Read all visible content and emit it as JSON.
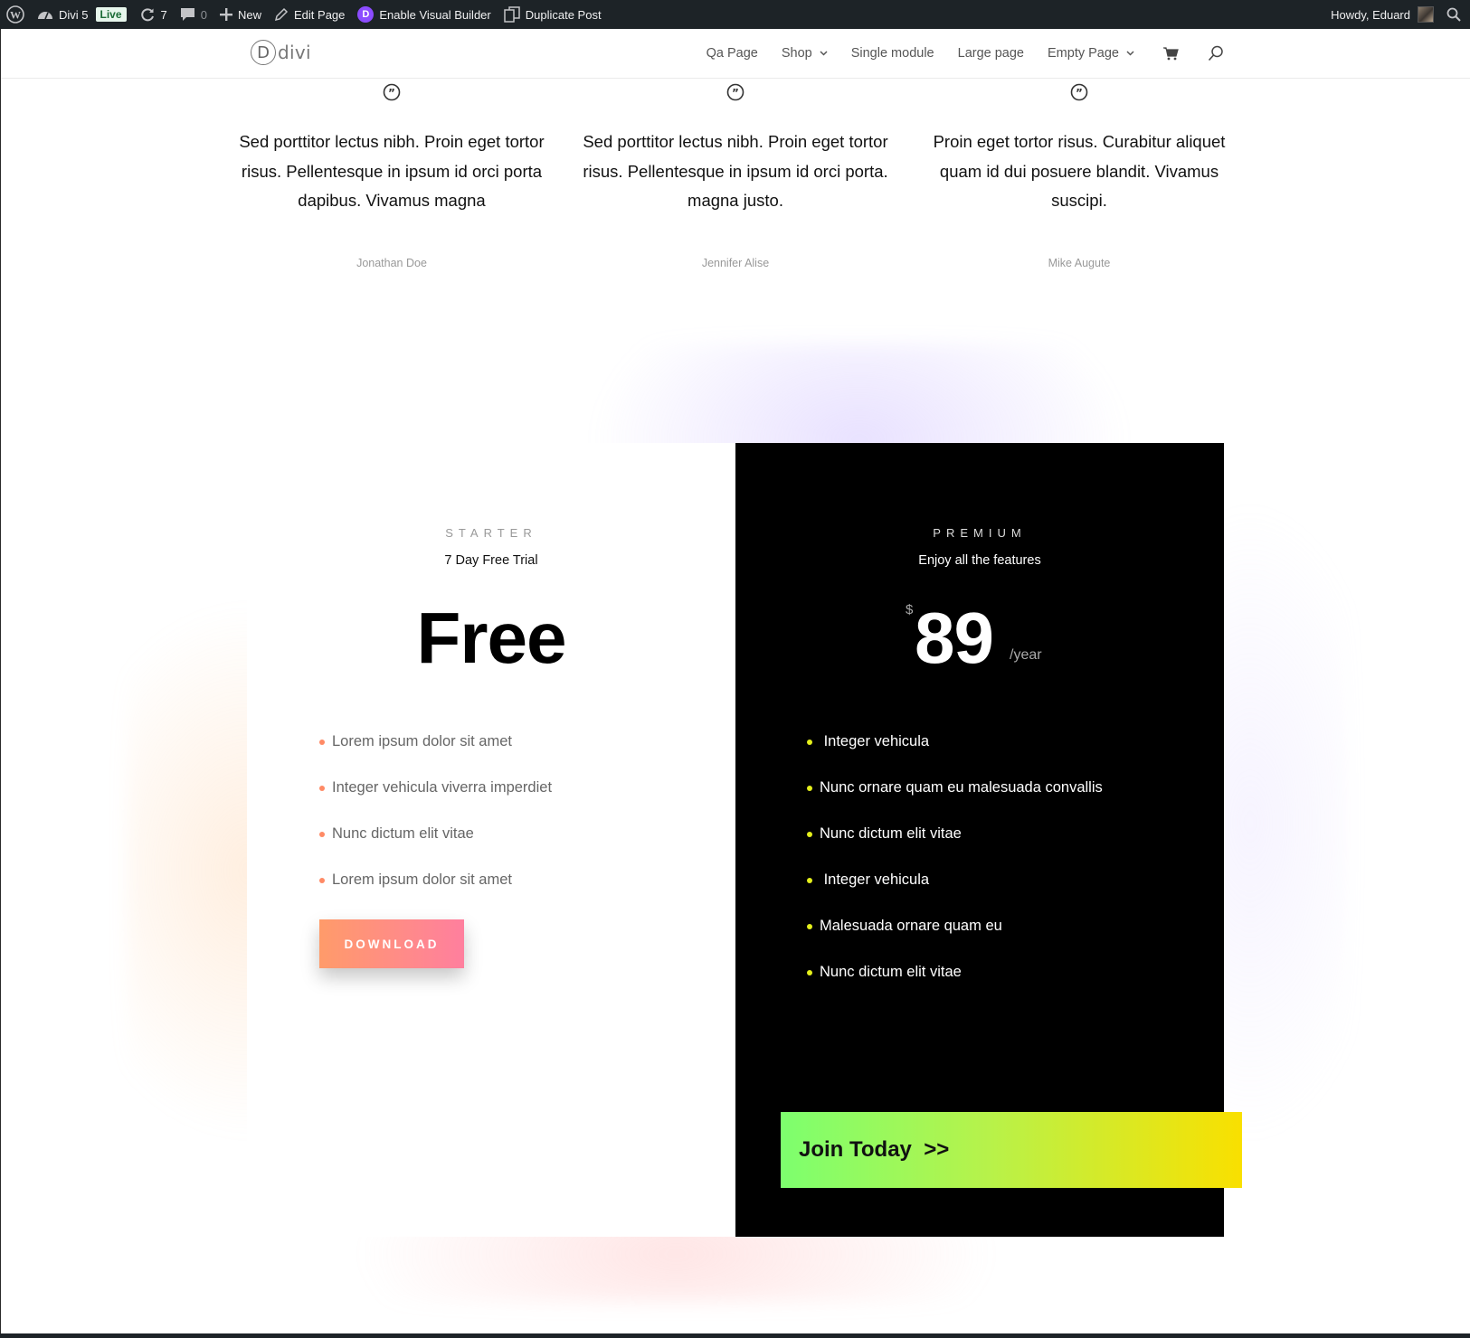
{
  "adminbar": {
    "site_name": "Divi 5",
    "live_badge": "Live",
    "updates_count": "7",
    "comments_count": "0",
    "new_label": "New",
    "edit_page_label": "Edit Page",
    "visual_builder_label": "Enable Visual Builder",
    "divi_letter": "D",
    "duplicate_label": "Duplicate Post",
    "greeting": "Howdy, Eduard"
  },
  "header": {
    "logo_letter": "D",
    "logo_text": "divi",
    "nav": [
      "Qa Page",
      "Shop",
      "Single module",
      "Large page",
      "Empty Page"
    ]
  },
  "testimonials": [
    {
      "body": "Sed porttitor lectus nibh. Proin eget tortor risus. Pellentesque in ipsum id orci porta dapibus. Vivamus magna",
      "author": "Jonathan Doe"
    },
    {
      "body": "Sed porttitor lectus nibh. Proin eget tortor risus. Pellentesque in ipsum id orci porta. magna justo.",
      "author": "Jennifer Alise"
    },
    {
      "body": "Proin eget tortor risus. Curabitur aliquet quam id dui posuere blandit. Vivamus suscipi.",
      "author": "Mike Augute"
    }
  ],
  "pricing": {
    "starter": {
      "name": "STARTER",
      "subtitle": "7 Day Free Trial",
      "price": "Free",
      "features": [
        "Lorem ipsum dolor sit amet",
        "Integer vehicula viverra imperdiet",
        "Nunc dictum elit vitae",
        "Lorem ipsum dolor sit amet"
      ],
      "button": "DOWNLOAD"
    },
    "premium": {
      "name": "PREMIUM",
      "subtitle": "Enjoy all the features",
      "currency": "$",
      "price": "89",
      "period": "/year",
      "features": [
        " Integer vehicula",
        "Nunc ornare quam eu malesuada convallis",
        "Nunc dictum elit vitae",
        " Integer vehicula",
        "Malesuada ornare quam eu",
        "Nunc dictum elit vitae"
      ],
      "button": "Join Today  >>"
    }
  },
  "colors": {
    "adminbar_bg": "#1d2327",
    "starter_accent": "#ff8a65",
    "premium_bullet": "#e4ef1b",
    "join_gradient_start": "#7dff6e",
    "join_gradient_end": "#f9e000"
  }
}
